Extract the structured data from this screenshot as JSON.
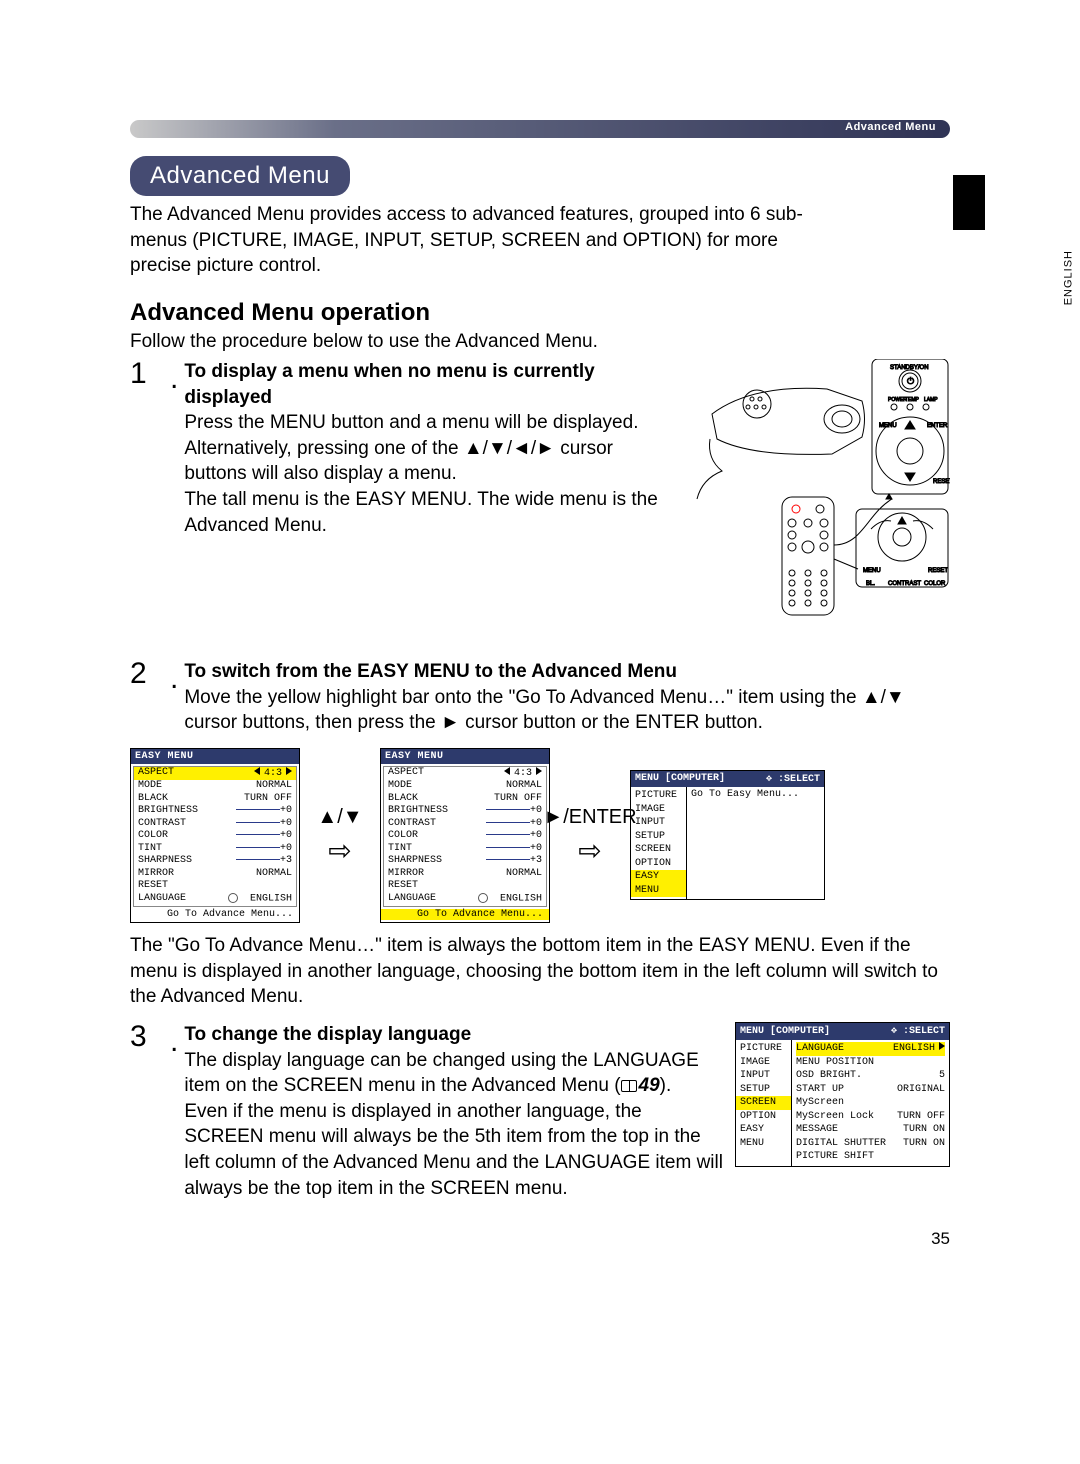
{
  "header": {
    "label": "Advanced Menu"
  },
  "side_lang": "ENGLISH",
  "pill": "Advanced Menu",
  "intro": "The Advanced Menu provides access to advanced features, grouped into 6 sub-menus (PICTURE, IMAGE, INPUT, SETUP, SCREEN and OPTION) for more precise picture control.",
  "section_title": "Advanced Menu operation",
  "follow": "Follow the procedure below to use the Advanced Menu.",
  "steps": {
    "s1": {
      "num": "1",
      "title": "To display a menu when no menu is currently displayed",
      "p1": "Press the MENU button and a menu will be displayed. Alternatively, pressing one of the ▲/▼/◄/► cursor buttons will also display a menu.",
      "p2": "The tall menu is the EASY MENU. The wide menu is the Advanced Menu."
    },
    "s2": {
      "num": "2",
      "title": "To switch from the EASY MENU to the Advanced Menu",
      "p1": "Move the yellow highlight bar onto the \"Go To Advanced Menu…\" item using the ▲/▼ cursor buttons, then press the ► cursor button or the ENTER button."
    },
    "s3": {
      "num": "3",
      "title": "To change the display language",
      "p1a": "The display language can be changed using the LANGUAGE item on the SCREEN menu in the Advanced Menu (",
      "ref": "49",
      "p1b": ").",
      "p2": "Even if the menu is displayed in another language, the SCREEN menu will always be the 5th item from the top in the left column of the Advanced Menu and the LANGUAGE item will always be the top item in the SCREEN menu."
    }
  },
  "after_menus": "The \"Go To Advance Menu…\" item is always the bottom item in the EASY MENU. Even if the menu is displayed in another language, choosing the bottom item in the left column will switch to the Advanced Menu.",
  "easy_menu": {
    "title": "EASY MENU",
    "rows": [
      {
        "lbl": "ASPECT",
        "val": "4:3",
        "arrows": true
      },
      {
        "lbl": "MODE",
        "val": "NORMAL"
      },
      {
        "lbl": "BLACK",
        "val": "TURN OFF"
      },
      {
        "lbl": "BRIGHTNESS",
        "val": "+0",
        "bar": true
      },
      {
        "lbl": "CONTRAST",
        "val": "+0",
        "bar": true
      },
      {
        "lbl": "COLOR",
        "val": "+0",
        "bar": true
      },
      {
        "lbl": "TINT",
        "val": "+0",
        "bar": true
      },
      {
        "lbl": "SHARPNESS",
        "val": "+3",
        "bar": true
      },
      {
        "lbl": "MIRROR",
        "val": "NORMAL"
      },
      {
        "lbl": "RESET",
        "val": ""
      },
      {
        "lbl": "LANGUAGE",
        "val": "ENGLISH",
        "globe": true
      }
    ],
    "bottom": "Go To Advance Menu..."
  },
  "arrow_labels": {
    "updown": "▲/▼",
    "enter": "►/ENTER"
  },
  "adv_menu": {
    "head_l": "MENU [COMPUTER]",
    "head_r": ":SELECT",
    "head_icon": "✥",
    "left": [
      "PICTURE",
      "IMAGE",
      "INPUT",
      "SETUP",
      "SCREEN",
      "OPTION",
      "EASY MENU"
    ],
    "right_goto": "Go To Easy Menu..."
  },
  "adv_menu_screen": {
    "left": [
      "PICTURE",
      "IMAGE",
      "INPUT",
      "SETUP",
      "SCREEN",
      "OPTION",
      "EASY MENU"
    ],
    "rows": [
      {
        "lbl": "LANGUAGE",
        "val": "ENGLISH",
        "hl": true
      },
      {
        "lbl": "MENU POSITION",
        "val": ""
      },
      {
        "lbl": "OSD BRIGHT.",
        "val": "5"
      },
      {
        "lbl": "START UP",
        "val": "ORIGINAL"
      },
      {
        "lbl": "MyScreen",
        "val": ""
      },
      {
        "lbl": "MyScreen Lock",
        "val": "TURN OFF"
      },
      {
        "lbl": "MESSAGE",
        "val": "TURN ON"
      },
      {
        "lbl": "DIGITAL SHUTTER",
        "val": "TURN ON"
      },
      {
        "lbl": "PICTURE SHIFT",
        "val": ""
      }
    ]
  },
  "page_number": "35"
}
